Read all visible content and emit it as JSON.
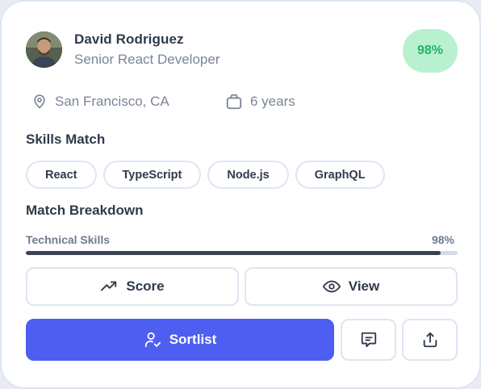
{
  "candidate": {
    "name": "David Rodriguez",
    "title": "Senior React Developer",
    "match_score": "98%",
    "match_color": "#22b36a",
    "location": "San Francisco, CA",
    "experience": "6 years"
  },
  "skills_section": {
    "title": "Skills Match",
    "skills": [
      "React",
      "TypeScript",
      "Node.js",
      "GraphQL"
    ]
  },
  "breakdown": {
    "title": "Match Breakdown",
    "items": [
      {
        "label": "Technical Skills",
        "value_text": "98%",
        "value": 0.96
      }
    ]
  },
  "actions": {
    "score_label": "Score",
    "view_label": "View",
    "primary_label": "Sortlist",
    "primary_color": "#4e5ef0"
  },
  "icons": {
    "location": "map-pin-icon",
    "experience": "briefcase-icon",
    "score": "trending-up-icon",
    "view": "eye-icon",
    "primary": "user-check-icon",
    "comment": "message-square-icon",
    "share": "share-icon"
  }
}
